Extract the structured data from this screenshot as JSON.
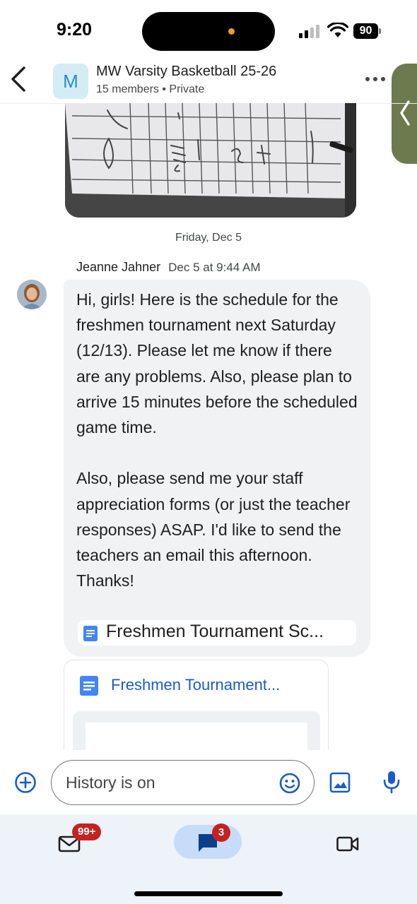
{
  "status_bar": {
    "time": "9:20",
    "battery": "90"
  },
  "header": {
    "avatar_letter": "M",
    "title": "MW Varsity Basketball 25-26",
    "subtitle": "15 members  •  Private"
  },
  "chat": {
    "day_divider": "Friday, Dec 5",
    "message": {
      "sender": "Jeanne Jahner",
      "time": "Dec 5 at 9:44 AM",
      "text": "Hi, girls! Here is the schedule for the freshmen tournament next Saturday (12/13). Please let me know if there are any problems. Also, please plan to arrive 15 minutes before the scheduled game time.\n\nAlso, please send me your staff appreciation forms (or just the teacher responses) ASAP. I'd like to send the teachers an email this afternoon. Thanks!",
      "attachment_chip": "Freshmen Tournament Sc...",
      "doc_card_title": "Freshmen Tournament..."
    }
  },
  "composer": {
    "placeholder": "History is on"
  },
  "bottom_nav": {
    "mail_badge": "99+",
    "chat_badge": "3",
    "active_tab": "chat"
  },
  "icons": {
    "back": "chevron-left-icon",
    "more": "more-horizontal-icon",
    "side_tab": "chevron-left-icon",
    "doc": "google-docs-icon",
    "add": "add-circle-icon",
    "emoji": "emoji-icon",
    "image": "image-icon",
    "mic": "mic-icon",
    "mail": "mail-icon",
    "chat": "chat-icon",
    "meet": "video-icon"
  },
  "colors": {
    "accent": "#1a73e8",
    "badge": "#c5221f",
    "bubble": "#f1f2f4",
    "nav_background": "#eef2f9",
    "chat_pill": "#c6dcf8"
  }
}
